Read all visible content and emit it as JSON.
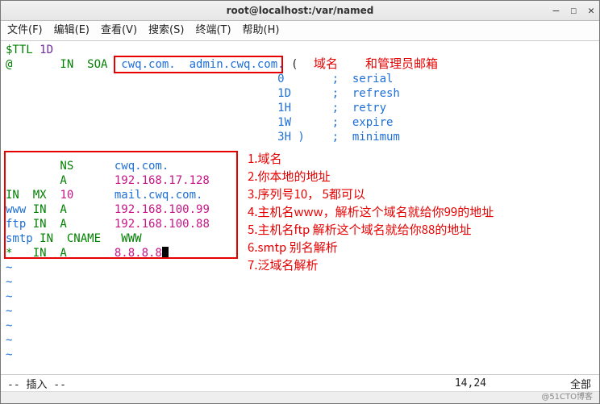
{
  "window": {
    "title": "root@localhost:/var/named"
  },
  "titlebar_controls": {
    "min": "—",
    "max": "☐",
    "close": "✕"
  },
  "menu": {
    "file": "文件(F)",
    "edit": "编辑(E)",
    "view": "查看(V)",
    "search": "搜索(S)",
    "term": "终端(T)",
    "help": "帮助(H)"
  },
  "zone": {
    "line1a": "$TTL ",
    "line1b": "1D",
    "line2a": "@       IN  SOA  ",
    "line2b": "cwq.com.  admin.cwq.com.",
    "line2c": " (",
    "body": "                                        0       ;  serial\n                                        1D      ;  refresh\n                                        1H      ;  retry\n                                        1W      ;  expire\n                                        3H )    ;  minimum",
    "r1a": "        NS      ",
    "r1b": "cwq.com.",
    "r2a": "        A       ",
    "r2b": "192.168.17.128",
    "r3a": "IN  MX  ",
    "r3b": "10",
    "r3c": "      ",
    "r3d": "mail.cwq.com.",
    "r4a": "www ",
    "r4b": "IN  A       ",
    "r4c": "192.168.100.99",
    "r5a": "ftp ",
    "r5b": "IN  A       ",
    "r5c": "192.168.100.88",
    "r6a": "smtp ",
    "r6b": "IN  CNAME   WWW",
    "r7a": "*   IN  A       ",
    "r7b": "8.8.8.8"
  },
  "tilde": "~",
  "annot": {
    "top1": "域名",
    "top2": "和管理员邮箱",
    "n1": "1.域名",
    "n2": "2.你本地的地址",
    "n3": "3.序列号10， 5都可以",
    "n4": "4.主机名www，解析这个域名就给你99的地址",
    "n5": "5.主机名ftp    解析这个域名就给你88的地址",
    "n6": "6.smtp  别名解析",
    "n7": "7.泛域名解析"
  },
  "status": {
    "left": "-- 插入 --",
    "center": "14,24",
    "right": "全部"
  },
  "footer": "@51CTO博客"
}
